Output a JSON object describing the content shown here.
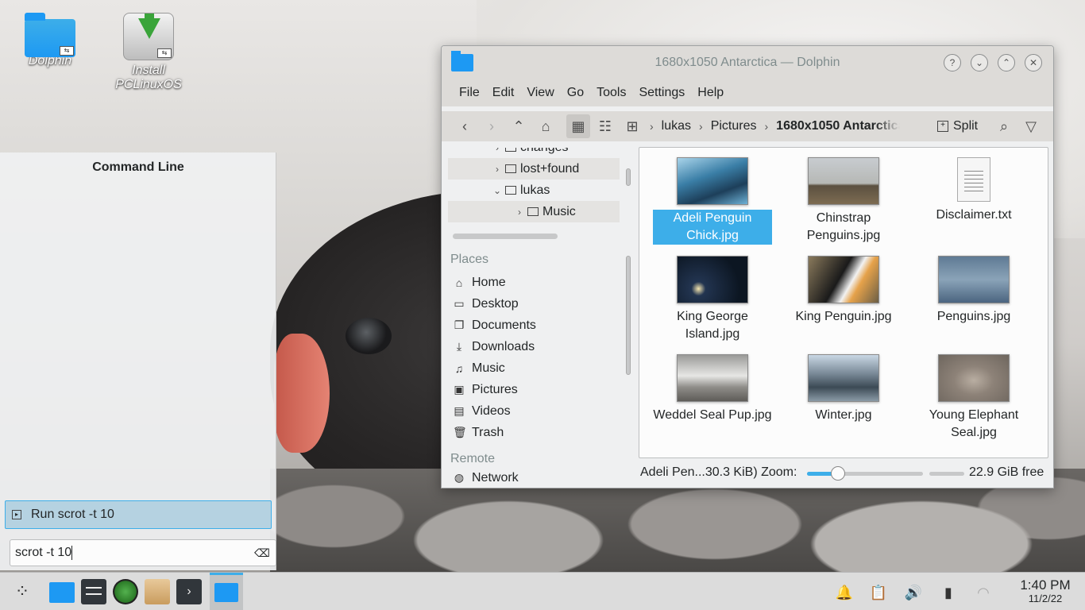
{
  "desktop": {
    "icons": [
      {
        "label": "Dolphin",
        "icon": "folder-icon"
      },
      {
        "label": "Install\nPCLinuxOS",
        "icon": "install-drive-icon"
      }
    ]
  },
  "krunner": {
    "title": "Command Line",
    "result_label": "Run scrot -t 10",
    "input_value": "scrot -t 10"
  },
  "dolphin": {
    "window_title": "1680x1050 Antarctica — Dolphin",
    "menu": [
      "File",
      "Edit",
      "View",
      "Go",
      "Tools",
      "Settings",
      "Help"
    ],
    "breadcrumb": [
      "lukas",
      "Pictures",
      "1680x1050 Antarctica"
    ],
    "split_label": "Split",
    "tree": [
      {
        "label": "changes",
        "expanded": false
      },
      {
        "label": "lost+found",
        "expanded": false
      },
      {
        "label": "lukas",
        "expanded": true
      },
      {
        "label": "Music",
        "expanded": false
      }
    ],
    "places_title": "Places",
    "places": [
      {
        "label": "Home",
        "icon": "home-icon"
      },
      {
        "label": "Desktop",
        "icon": "desktop-icon"
      },
      {
        "label": "Documents",
        "icon": "documents-icon"
      },
      {
        "label": "Downloads",
        "icon": "downloads-icon"
      },
      {
        "label": "Music",
        "icon": "music-icon"
      },
      {
        "label": "Pictures",
        "icon": "pictures-icon"
      },
      {
        "label": "Videos",
        "icon": "videos-icon"
      },
      {
        "label": "Trash",
        "icon": "trash-icon"
      }
    ],
    "remote_title": "Remote",
    "remote": [
      {
        "label": "Network",
        "icon": "network-icon"
      }
    ],
    "files": [
      {
        "name": "Adeli Penguin Chick.jpg",
        "selected": true
      },
      {
        "name": "Chinstrap Penguins.jpg",
        "selected": false
      },
      {
        "name": "Disclaimer.txt",
        "selected": false
      },
      {
        "name": "King George Island.jpg",
        "selected": false
      },
      {
        "name": "King Penguin.jpg",
        "selected": false
      },
      {
        "name": "Penguins.jpg",
        "selected": false
      },
      {
        "name": "Weddel Seal Pup.jpg",
        "selected": false
      },
      {
        "name": "Winter.jpg",
        "selected": false
      },
      {
        "name": "Young Elephant Seal.jpg",
        "selected": false
      }
    ],
    "status": {
      "selection": "Adeli Pen...30.3 KiB)",
      "zoom_label": "Zoom:",
      "zoom_level": 0.27,
      "free_space": "22.9 GiB free"
    }
  },
  "taskbar": {
    "clock_time": "1:40 PM",
    "clock_date": "11/2/22"
  },
  "colors": {
    "accent": "#3daee9",
    "selection_bg": "#3daee9",
    "folder_blue": "#1d99f3"
  }
}
